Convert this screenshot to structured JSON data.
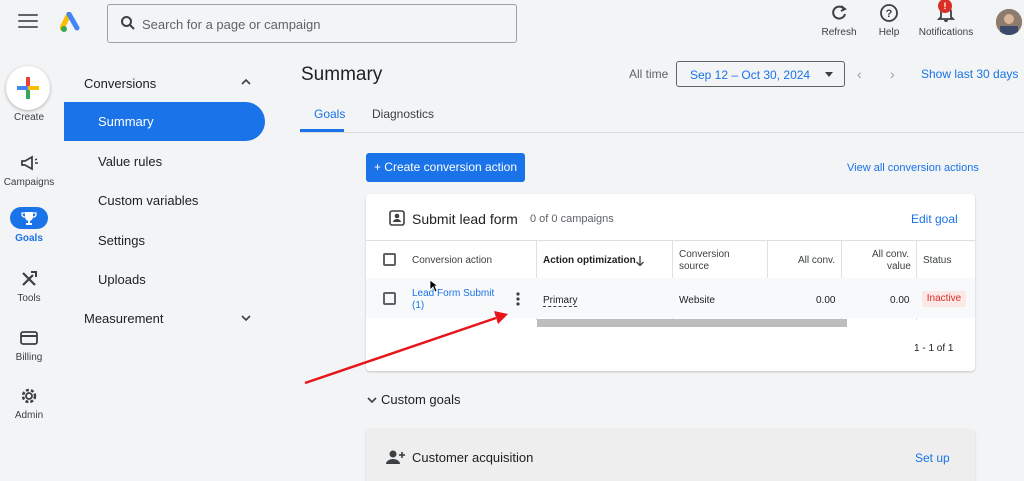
{
  "topbar": {
    "search_placeholder": "Search for a page or campaign",
    "refresh_label": "Refresh",
    "help_label": "Help",
    "notifications_label": "Notifications",
    "notifications_badge": "!"
  },
  "rail": {
    "create_label": "Create",
    "campaigns_label": "Campaigns",
    "goals_label": "Goals",
    "tools_label": "Tools",
    "billing_label": "Billing",
    "admin_label": "Admin"
  },
  "subnav": {
    "conversions_label": "Conversions",
    "items": [
      {
        "label": "Summary",
        "active": true
      },
      {
        "label": "Value rules"
      },
      {
        "label": "Custom variables"
      },
      {
        "label": "Settings"
      },
      {
        "label": "Uploads"
      }
    ],
    "measurement_label": "Measurement"
  },
  "header": {
    "title": "Summary",
    "all_time_label": "All time",
    "date_range": "Sep 12 – Oct 30, 2024",
    "show_last_label": "Show last 30 days"
  },
  "tabs": [
    {
      "label": "Goals",
      "active": true
    },
    {
      "label": "Diagnostics"
    }
  ],
  "actions": {
    "create_conversion_label": "+ Create conversion action",
    "view_all_label": "View all conversion actions"
  },
  "goal_card": {
    "title": "Submit lead form",
    "campaigns": "0 of 0 campaigns",
    "edit_label": "Edit goal",
    "columns": {
      "conversion_action": "Conversion action",
      "action_optimization": "Action optimization",
      "conversion_source_1": "Conversion",
      "conversion_source_2": "source",
      "all_conv": "All conv.",
      "all_conv_value_1": "All conv.",
      "all_conv_value_2": "value",
      "status": "Status"
    },
    "rows": [
      {
        "name_1": "Lead Form Submit",
        "name_2": "(1)",
        "optimization": "Primary",
        "source": "Website",
        "all_conv": "0.00",
        "all_conv_value": "0.00",
        "status": "Inactive"
      }
    ],
    "pagination": "1 - 1 of 1"
  },
  "custom_goals_label": "Custom goals",
  "customer_card": {
    "title": "Customer acquisition",
    "setup_label": "Set up"
  },
  "colors": {
    "accent": "#1a73e8",
    "inactive": "#d93025",
    "annotation_arrow": "#e8141a"
  }
}
